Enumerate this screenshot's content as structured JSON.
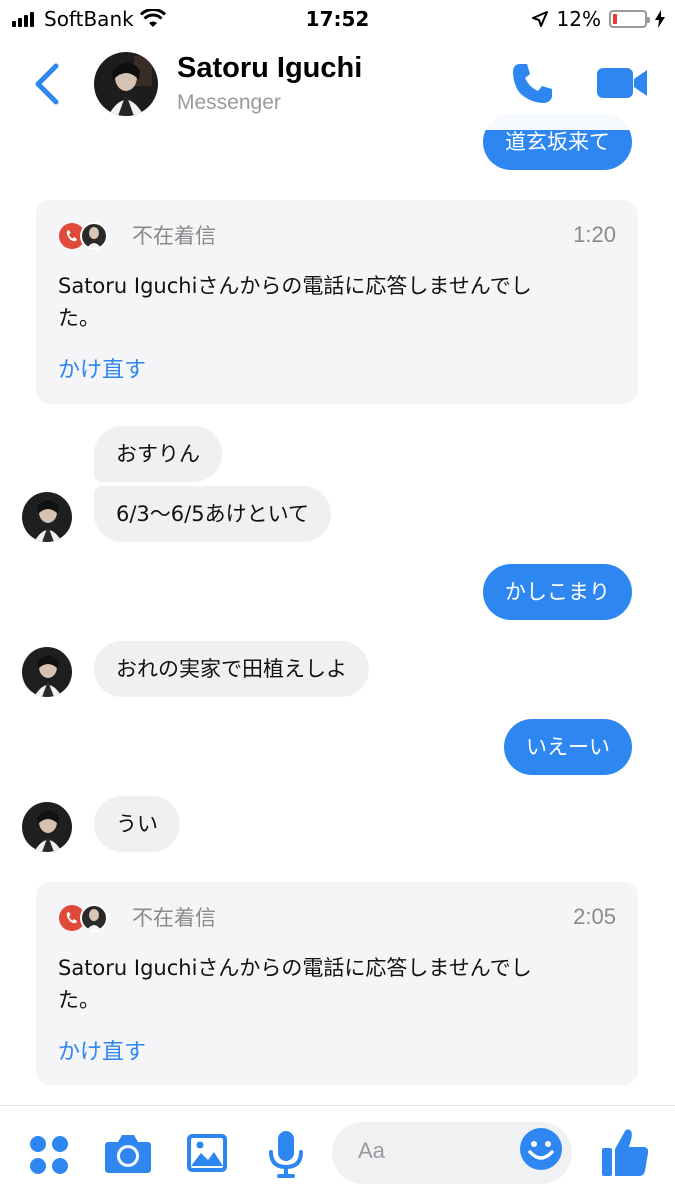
{
  "status_bar": {
    "carrier": "SoftBank",
    "time": "17:52",
    "battery_percent": "12%",
    "battery_level": 0.12
  },
  "header": {
    "name": "Satoru Iguchi",
    "subtitle": "Messenger"
  },
  "messages": [
    {
      "type": "outgoing",
      "text": "道玄坂来て"
    },
    {
      "type": "missed_call",
      "title": "不在着信",
      "time": "1:20",
      "body_line1": "Satoru Iguchiさんからの電話に応答しませんでし",
      "body_line2": "た。",
      "action": "かけ直す"
    },
    {
      "type": "incoming",
      "text": "おすりん"
    },
    {
      "type": "incoming",
      "text": "6/3〜6/5あけといて"
    },
    {
      "type": "outgoing",
      "text": "かしこまり"
    },
    {
      "type": "incoming",
      "text": "おれの実家で田植えしよ"
    },
    {
      "type": "outgoing",
      "text": "いえーい"
    },
    {
      "type": "incoming",
      "text": "うい"
    },
    {
      "type": "missed_call",
      "title": "不在着信",
      "time": "2:05",
      "body_line1": "Satoru Iguchiさんからの電話に応答しませんでし",
      "body_line2": "た。",
      "action": "かけ直す"
    }
  ],
  "composer": {
    "placeholder": "Aa"
  },
  "colors": {
    "accent": "#2e87f0",
    "incoming_bubble": "#f0f0f0",
    "missed_call_red": "#e04a3a"
  },
  "icons": [
    "signal-icon",
    "wifi-icon",
    "location-icon",
    "battery-icon",
    "charging-icon",
    "back-chevron-icon",
    "phone-icon",
    "video-icon",
    "apps-grid-icon",
    "camera-icon",
    "image-icon",
    "microphone-icon",
    "emoji-icon",
    "like-thumb-icon"
  ]
}
